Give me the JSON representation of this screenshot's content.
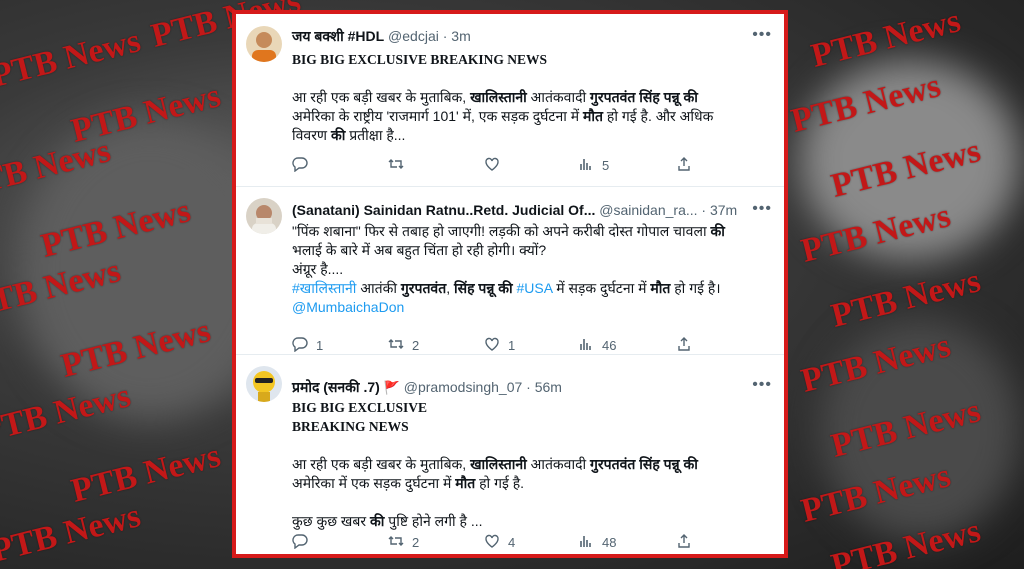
{
  "watermark": "PTB News",
  "tweets": [
    {
      "name": "जय बक्शी #HDL",
      "handle": "@edcjai · 3m",
      "headline": "BIG BIG EXCLUSIVE BREAKING NEWS",
      "p1_a": "आ रही एक बड़ी खबर के मुताबिक, ",
      "p1_b": "खालिस्तानी",
      "p1_c": " आतंकवादी ",
      "p1_d": "गुरपतवंत सिंह पन्नू की",
      "p2_a": "अमेरिका के राष्ट्रीय 'राजमार्ग 101' में, एक सड़क दुर्घटना में ",
      "p2_b": "मौत",
      "p2_c": " हो गई है. और अधिक",
      "p3_a": "विवरण ",
      "p3_b": "की",
      "p3_c": " प्रतीक्षा है...",
      "stats": {
        "reply": "",
        "retweet": "",
        "like": "",
        "views": "5"
      }
    },
    {
      "name": "(Sanatani) Sainidan Ratnu..Retd. Judicial Of...",
      "handle": "@sainidan_ra... · 37m",
      "l1_a": "\"पिंक शबाना\" फिर से तबाह हो जाएगी! लड़की को अपने करीबी दोस्त गोपाल चावला ",
      "l1_b": "की",
      "l2": "भलाई के बारे में अब बहुत चिंता हो रही होगी। क्यों?",
      "l3": "अंग्रूर है....",
      "l4_a": "#खालिस्तानी",
      "l4_b": " आतंकी ",
      "l4_c": "गुरपतवंत",
      "l4_d": ", ",
      "l4_e": "सिंह पन्नू की",
      "l4_f": " ",
      "l4_g": "#USA",
      "l4_h": " में सड़क दुर्घटना में ",
      "l4_i": "मौत",
      "l4_j": " हो गई है।",
      "l5": "@MumbaichaDon",
      "stats": {
        "reply": "1",
        "retweet": "2",
        "like": "1",
        "views": "46"
      }
    },
    {
      "name": "प्रमोद (सनकी .7)",
      "handle": "@pramodsingh_07 · 56m",
      "headline1": "BIG BIG EXCLUSIVE",
      "headline2": "BREAKING NEWS",
      "p1_a": "आ रही एक बड़ी खबर के मुताबिक, ",
      "p1_b": "खालिस्तानी",
      "p1_c": " आतंकवादी ",
      "p1_d": "गुरपतवंत सिंह पन्नू की",
      "p2_a": "अमेरिका में एक सड़क दुर्घटना में ",
      "p2_b": "मौत",
      "p2_c": " हो गई है.",
      "p3_a": "कुछ कुछ खबर ",
      "p3_b": "की",
      "p3_c": " पुष्टि होने लगी है ...",
      "stats": {
        "reply": "",
        "retweet": "2",
        "like": "4",
        "views": "48"
      }
    }
  ]
}
